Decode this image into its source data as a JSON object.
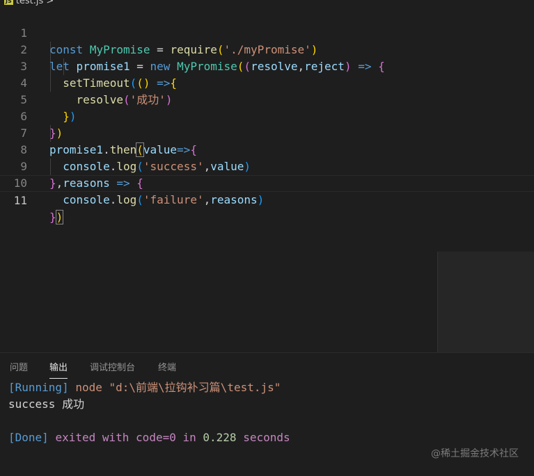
{
  "breadcrumb": {
    "file_icon": "JS",
    "path": "test.js >"
  },
  "editor": {
    "line_numbers": [
      "1",
      "2",
      "3",
      "4",
      "5",
      "6",
      "7",
      "8",
      "9",
      "10",
      "11"
    ],
    "tokens": {
      "l1": [
        "const",
        "MyPromise",
        "=",
        "require",
        "(",
        "'./myPromise'",
        ")"
      ],
      "l2": [
        "let",
        "promise1",
        "=",
        "new",
        "MyPromise",
        "(",
        "(",
        "resolve",
        ",",
        "reject",
        ")",
        "=>",
        "{"
      ],
      "l3": [
        "setTimeout",
        "(",
        "(",
        ")",
        "=>",
        "{"
      ],
      "l4": [
        "resolve",
        "(",
        "'成功'",
        ")"
      ],
      "l5": [
        "}",
        ")"
      ],
      "l6": [
        "}",
        ")"
      ],
      "l7": [
        "promise1",
        ".",
        "then",
        "(",
        "value",
        "=>",
        "{"
      ],
      "l8": [
        "console",
        ".",
        "log",
        "(",
        "'success'",
        ",",
        "value",
        ")"
      ],
      "l9": [
        "}",
        ",",
        "reasons",
        "=>",
        "{"
      ],
      "l10": [
        "console",
        ".",
        "log",
        "(",
        "'failure'",
        ",",
        "reasons",
        ")"
      ],
      "l11": [
        "}",
        ")"
      ]
    }
  },
  "panel": {
    "tabs": [
      "问题",
      "输出",
      "调试控制台",
      "终端"
    ],
    "active_tab": "输出",
    "output": {
      "running_tag": "[Running]",
      "running_cmd": "node",
      "running_path": "\"d:\\前端\\拉钩补习篇\\test.js\"",
      "result_line": "success 成功",
      "done_tag": "[Done]",
      "done_exited": "exited with",
      "done_code": "code=0",
      "done_in": "in",
      "done_time": "0.228",
      "done_seconds": "seconds"
    }
  },
  "watermark": "@稀土掘金技术社区",
  "colors": {
    "background": "#1e1e1e",
    "keyword": "#569cd6",
    "string": "#ce9178",
    "function": "#dcdcaa",
    "variable": "#9cdcfe",
    "class": "#4ec9b0"
  }
}
